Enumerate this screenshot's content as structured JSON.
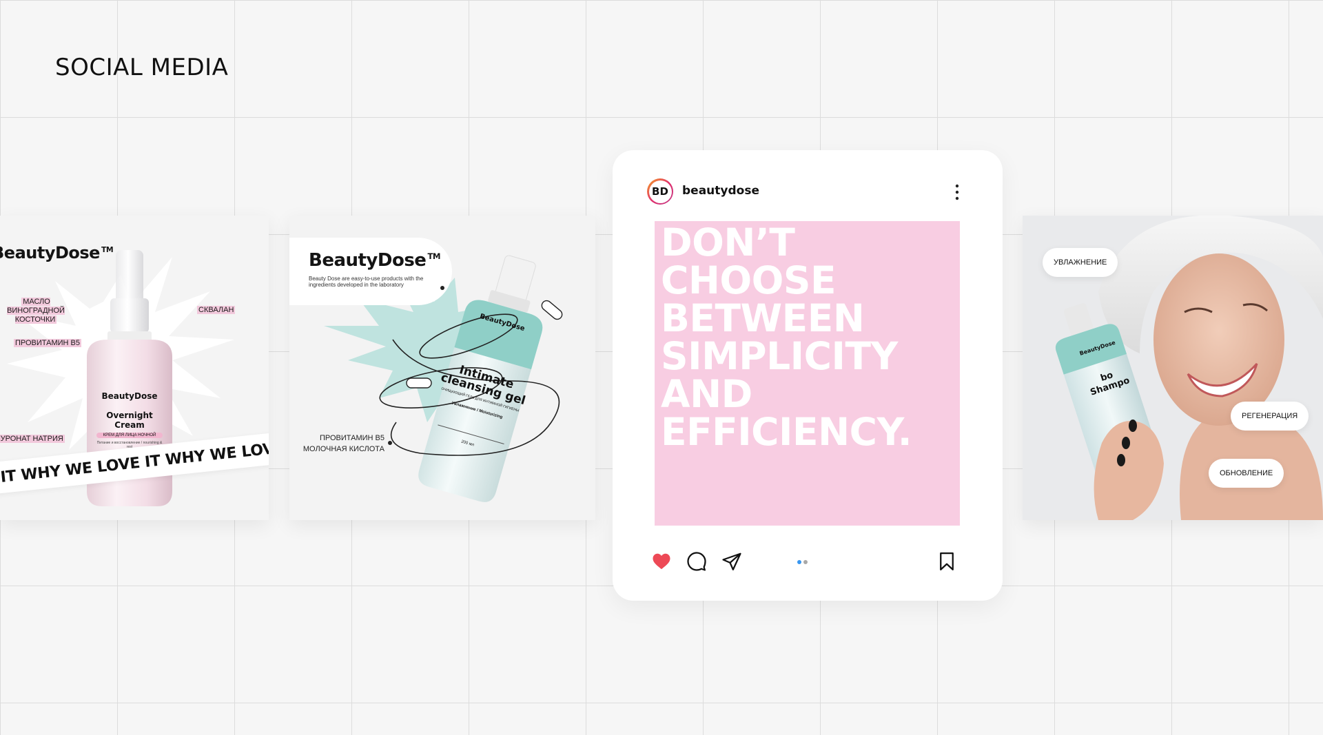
{
  "section_title": "SOCIAL MEDIA",
  "tile1": {
    "brand": "BeautyDose",
    "trademark": "TM",
    "ingredients": [
      "МАСЛО ВИНОГРАДНОЙ КОСТОЧКИ",
      "СКВАЛАН",
      "ПРОВИТАМИН B5",
      "ГИАЛУРОНАТ НАТРИЯ"
    ],
    "band_text": "LOVE IT WHY WE LOVE IT WHY WE LOVE",
    "product": {
      "brand": "BeautyDose",
      "name": "Overnight Cream",
      "tag": "КРЕМ ДЛЯ ЛИЦА НОЧНОЙ",
      "sub": "Питание и восстановление / nourishing & rest"
    }
  },
  "tile2": {
    "brand": "BeautyDose",
    "trademark": "TM",
    "tagline": "Beauty Dose are easy-to-use products with the ingredients developed in the laboratory",
    "ingredients": [
      "ПРОВИТАМИН B5",
      "МОЛОЧНАЯ КИСЛОТА"
    ],
    "product": {
      "brand": "BeautyDose",
      "name_line1": "Intimate",
      "name_line2": "cleansing gel",
      "sub": "ОЧИЩАЮЩИЙ ГЕЛЬ ДЛЯ ИНТИМНОЙ ГИГИЕНЫ",
      "benefit": "Увлажнение / Moisturizing",
      "volume": "200 мл"
    }
  },
  "post": {
    "avatar": "BD",
    "username": "beautydose",
    "headline_lines": [
      "DON’T CHOOSE",
      "BETWEEN",
      "SIMPLICITY",
      "AND",
      "EFFICIENCY."
    ],
    "colors": {
      "image_bg": "#f8cde2",
      "like": "#ed4956",
      "dot_active": "#3897f0"
    },
    "icons": [
      "heart-icon",
      "comment-icon",
      "send-icon",
      "bookmark-icon",
      "more-vertical-icon"
    ],
    "carousel": {
      "count": 2,
      "active": 1
    }
  },
  "tile4": {
    "labels": [
      "УВЛАЖНЕНИЕ",
      "РЕГЕНЕРАЦИЯ",
      "ОБНОВЛЕНИЕ"
    ],
    "product": {
      "brand": "BeautyDose",
      "name": "bo Shampo"
    }
  }
}
